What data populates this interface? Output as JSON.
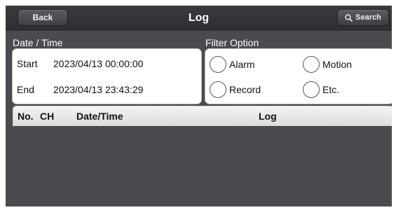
{
  "topbar": {
    "back_label": "Back",
    "title": "Log",
    "search_label": "Search"
  },
  "datetime": {
    "section_label": "Date / Time",
    "start_key": "Start",
    "start_value": "2023/04/13 00:00:00",
    "end_key": "End",
    "end_value": "2023/04/13 23:43:29"
  },
  "filter": {
    "section_label": "Filter Option",
    "options": [
      {
        "label": "Alarm",
        "checked": false
      },
      {
        "label": "Motion",
        "checked": false
      },
      {
        "label": "Record",
        "checked": false
      },
      {
        "label": "Etc.",
        "checked": false
      }
    ]
  },
  "table": {
    "columns": [
      "No.",
      "CH",
      "Date/Time",
      "Log"
    ],
    "rows": []
  },
  "colors": {
    "background": "#4a4a4f",
    "topbar": "#2e2e32",
    "panel": "#ffffff"
  },
  "icons": {
    "search": "search-icon"
  }
}
